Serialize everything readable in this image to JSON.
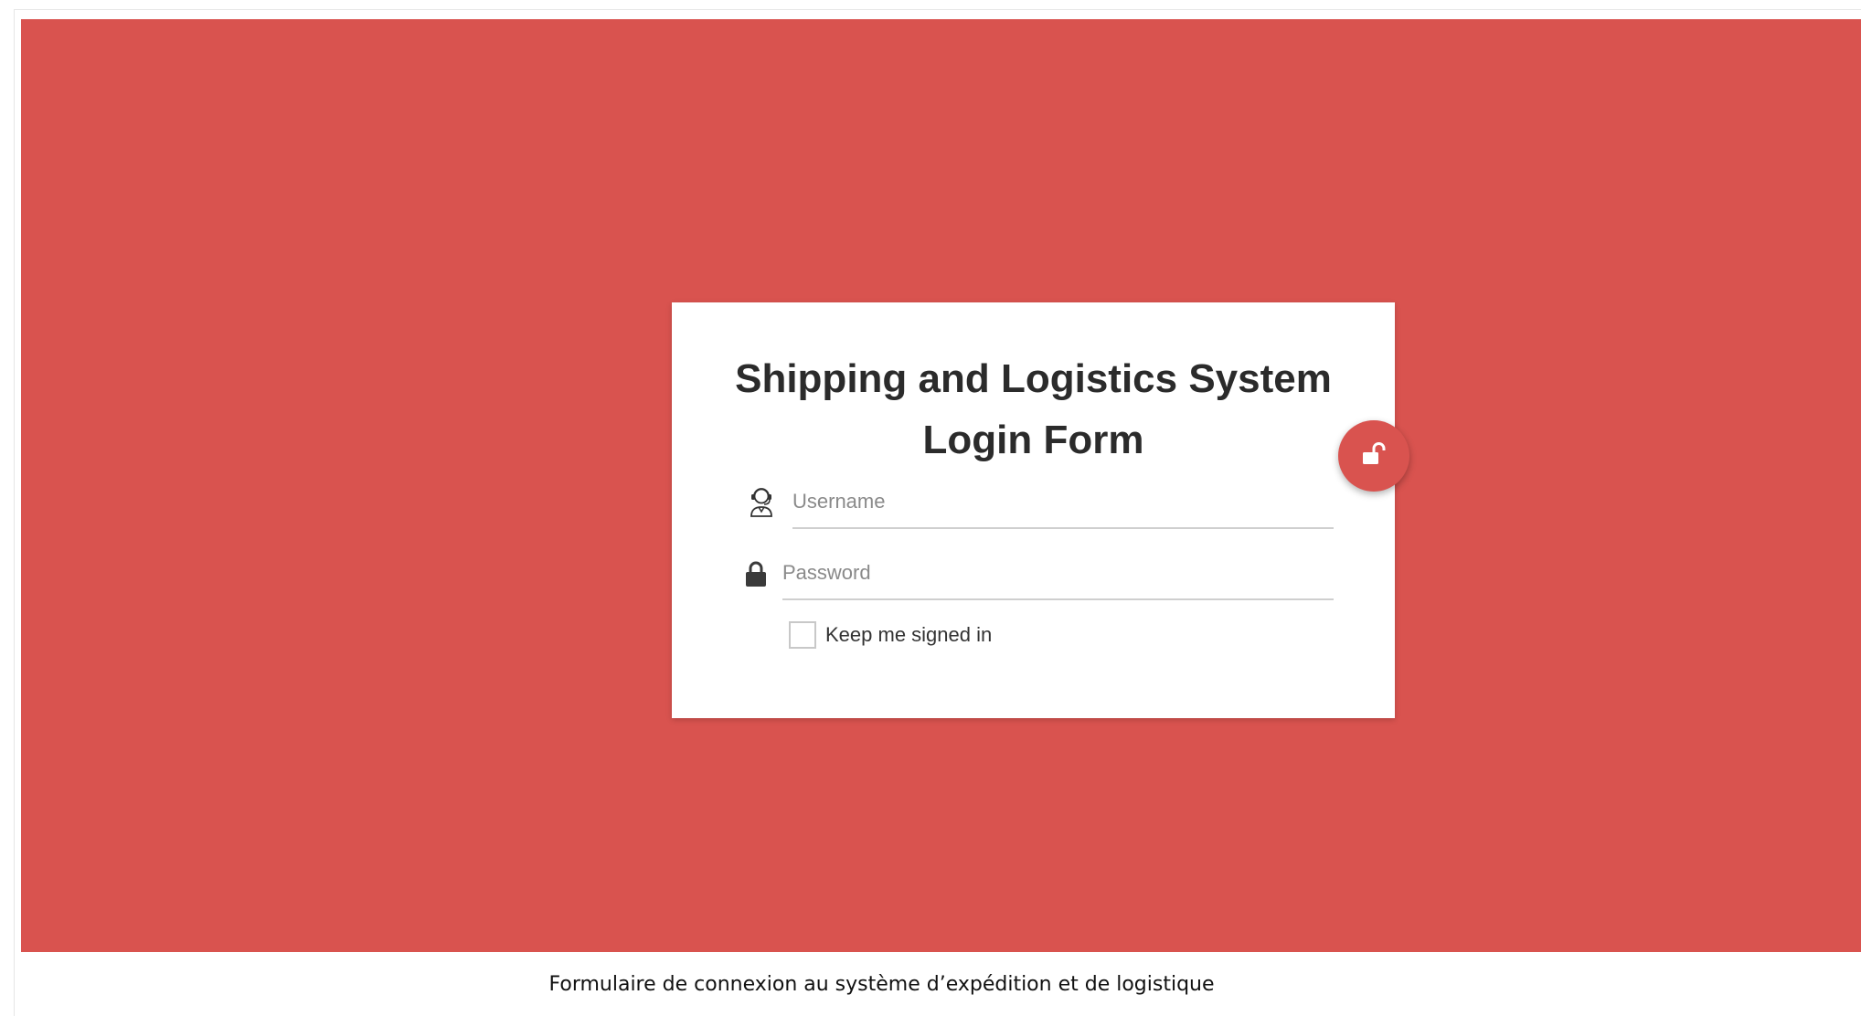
{
  "colors": {
    "background": "#d9534f",
    "card": "#ffffff",
    "accent": "#d9534f"
  },
  "login": {
    "title_line1": "Shipping and Logistics System",
    "title_line2": "Login Form",
    "username_placeholder": "Username",
    "password_placeholder": "Password",
    "remember_label": "Keep me signed in",
    "username_icon": "user-headset-icon",
    "password_icon": "lock-icon",
    "submit_icon": "unlock-icon"
  },
  "caption": {
    "text": "Formulaire de connexion au système d’expédition et de logistique"
  }
}
